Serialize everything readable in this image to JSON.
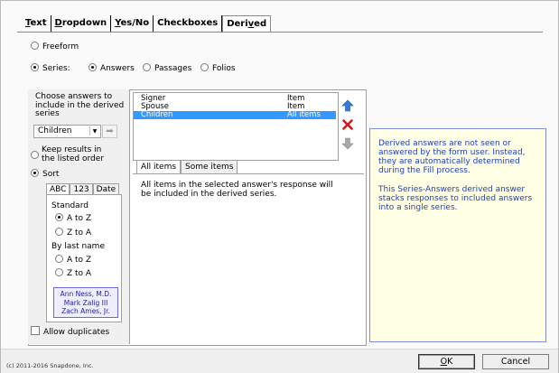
{
  "tabs": [
    {
      "label": "Text",
      "underline": "T",
      "rest": "ext"
    },
    {
      "label": "Dropdown",
      "underline": "D",
      "rest": "ropdown"
    },
    {
      "label": "Yes/No",
      "underline": "Y",
      "rest": "es/No"
    },
    {
      "label": "Checkboxes",
      "underline": "",
      "rest": "Checkboxes"
    },
    {
      "label": "Derived",
      "pre": "Deri",
      "underline": "v",
      "rest": "ed"
    }
  ],
  "mode": {
    "freeform_label": "Freeform",
    "series_label": "Series:",
    "series_options": [
      "Answers",
      "Passages",
      "Folios"
    ],
    "selected_mode": "Series",
    "selected_series": "Answers"
  },
  "choose": {
    "label": "Choose answers to include in the derived series",
    "combo_value": "Children",
    "keep_label": "Keep results in the listed order",
    "sort_label": "Sort",
    "selected_order": "Sort"
  },
  "answer_list": {
    "rows": [
      {
        "name": "Signer",
        "scope": "Item",
        "selected": false
      },
      {
        "name": "Spouse",
        "scope": "Item",
        "selected": false
      },
      {
        "name": "Children",
        "scope": "All items",
        "selected": true
      }
    ]
  },
  "item_tabs": [
    "All items",
    "Some items"
  ],
  "item_tab_active": "All items",
  "item_tab_desc": "All items in the selected answer's response will be included in the derived series.",
  "sort": {
    "tabs": [
      "ABC",
      "123",
      "Date"
    ],
    "active_tab": "ABC",
    "standard_label": "Standard",
    "standard_options": [
      "A to Z",
      "Z to A"
    ],
    "standard_selected": "A to Z",
    "lastname_label": "By last name",
    "lastname_options": [
      "A to Z",
      "Z to A"
    ],
    "lastname_selected": "",
    "sample_names": [
      "Ann Ness, M.D.",
      "Mark Zalig III",
      "Zach Ames, Jr."
    ]
  },
  "allow_duplicates_label": "Allow duplicates",
  "allow_duplicates_checked": false,
  "info": {
    "p1": "Derived answers are not seen or answered by the form user.  Instead, they are automatically determined during the Fill process.",
    "p2": "This Series-Answers derived answer stacks responses to included answers into a single series."
  },
  "footer": {
    "copyright": "(c) 2011-2016 Snapdone, Inc.",
    "ok_label": "OK",
    "ok_underline": "O",
    "ok_rest": "K",
    "cancel_label": "Cancel"
  },
  "colors": {
    "selection": "#3399ff",
    "info_text": "#1f3fbf",
    "info_bg": "#ffffe6",
    "up_arrow": "#3a78d8",
    "delete_x": "#d21a1a"
  }
}
